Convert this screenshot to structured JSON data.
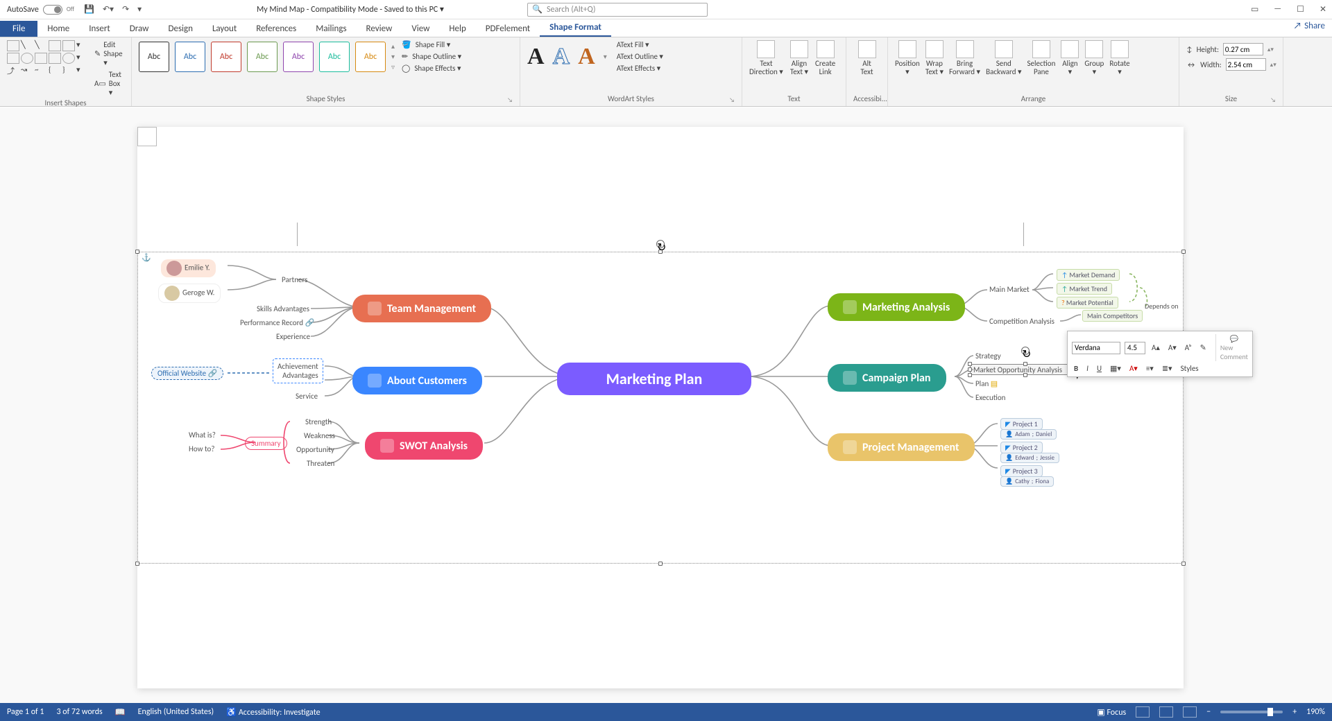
{
  "titlebar": {
    "autosave_label": "AutoSave",
    "autosave_state": "Off",
    "doc_title": "My Mind Map  -  Compatibility Mode  -  Saved to this PC ▾",
    "search_placeholder": "Search (Alt+Q)"
  },
  "tabs": {
    "file": "File",
    "items": [
      "Home",
      "Insert",
      "Draw",
      "Design",
      "Layout",
      "References",
      "Mailings",
      "Review",
      "View",
      "Help",
      "PDFelement"
    ],
    "active": "Shape Format",
    "share": "Share"
  },
  "ribbon": {
    "insert_shapes": {
      "label": "Insert Shapes",
      "edit_shape": "Edit Shape ▾",
      "text_box": "Text Box ▾"
    },
    "shape_styles": {
      "label": "Shape Styles",
      "gallery": [
        "Abc",
        "Abc",
        "Abc",
        "Abc",
        "Abc",
        "Abc",
        "Abc"
      ],
      "gallery_colors": [
        "#333",
        "#2b6cb0",
        "#c0392b",
        "#6a994e",
        "#8e44ad",
        "#1abc9c",
        "#d68910"
      ],
      "fill": "Shape Fill ▾",
      "outline": "Shape Outline ▾",
      "effects": "Shape Effects ▾"
    },
    "wordart": {
      "label": "WordArt Styles",
      "letters": [
        "A",
        "A",
        "A"
      ],
      "colors": [
        "#222",
        "#2b6cb0",
        "#c0651f"
      ],
      "text_fill": "Text Fill ▾",
      "text_outline": "Text Outline ▾",
      "text_effects": "Text Effects ▾"
    },
    "text": {
      "label": "Text",
      "dir": "Text\nDirection ▾",
      "align": "Align\nText ▾",
      "link": "Create\nLink"
    },
    "access": {
      "label": "Accessibi...",
      "alt": "Alt\nText"
    },
    "arrange": {
      "label": "Arrange",
      "btns": [
        "Position\n▾",
        "Wrap\nText ▾",
        "Bring\nForward ▾",
        "Send\nBackward ▾",
        "Selection\nPane",
        "Align\n▾",
        "Group\n▾",
        "Rotate\n▾"
      ]
    },
    "size": {
      "label": "Size",
      "height_lbl": "Height:",
      "height_val": "0.27 cm",
      "width_lbl": "Width:",
      "width_val": "2.54 cm"
    }
  },
  "mindmap": {
    "center": "Marketing Plan",
    "left": [
      {
        "title": "Team Management",
        "color": "#e76f51",
        "children": [
          "Partners",
          "Skills Advantages",
          "Performance Record",
          "Experience"
        ],
        "partners": [
          "Emilie Y.",
          "Geroge W."
        ]
      },
      {
        "title": "About Customers",
        "color": "#3a86ff",
        "children": [
          "Achievement",
          "Advantages",
          "Service"
        ],
        "link": "Official Website"
      },
      {
        "title": "SWOT Analysis",
        "color": "#ef476f",
        "children": [
          "Strength",
          "Weakness",
          "Opportunity",
          "Threaten"
        ],
        "summary": "Summary",
        "summary_q": [
          "What is?",
          "How to?"
        ]
      }
    ],
    "right": [
      {
        "title": "Marketing Analysis",
        "color": "#7cb518",
        "children": [
          "Main Market",
          "Competition Analysis"
        ],
        "mm_sub": [
          "Market Demand",
          "Market Trend",
          "Market Potential"
        ],
        "comp_sub": [
          "Main Competitors"
        ],
        "note": "Depends on"
      },
      {
        "title": "Campaign Plan",
        "color": "#2a9d8f",
        "children": [
          "Strategy",
          "Market Opportunity Analysis",
          "Plan",
          "Execution"
        ]
      },
      {
        "title": "Project Management",
        "color": "#e9c46a",
        "children": [
          "Project 1",
          "Project 2",
          "Project 3"
        ],
        "assign": [
          [
            "Adam",
            "Daniel"
          ],
          [
            "Edward",
            "Jessie"
          ],
          [
            "Cathy",
            "Fiona"
          ]
        ]
      }
    ]
  },
  "mini_toolbar": {
    "font": "Verdana",
    "size": "4.5",
    "buttons": [
      "A▴",
      "A▾",
      "Aᵇ",
      "✎"
    ],
    "row2": [
      "B",
      "I",
      "U",
      "▦▾",
      "A▾",
      "≡▾",
      "≣▾"
    ],
    "styles": "Styles",
    "new_comment": "New\nComment"
  },
  "status": {
    "page": "Page 1 of 1",
    "words": "3 of 72 words",
    "lang": "English (United States)",
    "access": "Accessibility: Investigate",
    "focus": "Focus",
    "zoom": "190%"
  }
}
